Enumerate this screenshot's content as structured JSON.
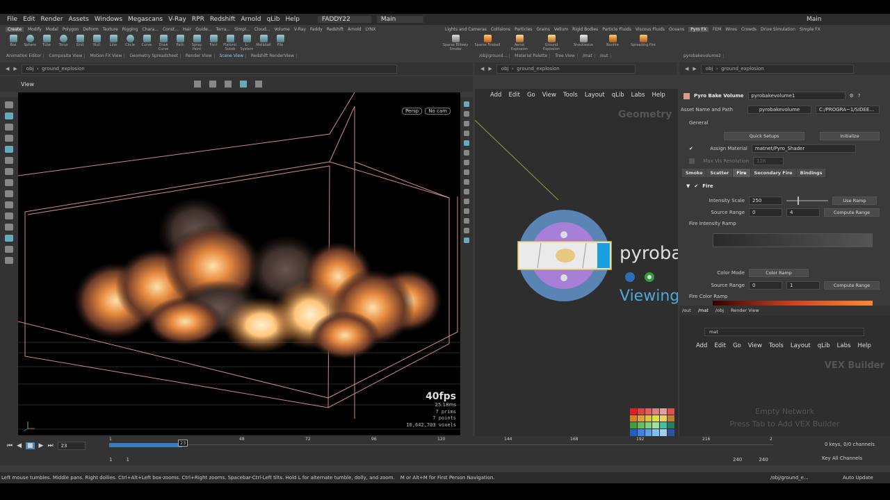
{
  "menu": [
    "File",
    "Edit",
    "Render",
    "Assets",
    "Windows",
    "Megascans",
    "V-Ray",
    "RPR",
    "Redshift",
    "Arnold",
    "qLib",
    "Help"
  ],
  "workspace": {
    "user": "FADDY22",
    "desktop": "Main",
    "right": "Main"
  },
  "shelf_tabs_left": [
    "Create",
    "Modify",
    "Model",
    "Polygon",
    "Deform",
    "Texture",
    "Rigging",
    "Chara...",
    "Const...",
    "Hair",
    "Guide...",
    "Terra...",
    "Simpl...",
    "Cloud...",
    "Volume",
    "V-Ray",
    "Faddy",
    "Redshift",
    "Arnold",
    "LYNX"
  ],
  "shelf_tabs_right": [
    "Lights and Cameras",
    "Collisions",
    "Particles",
    "Grains",
    "Vellum",
    "Rigid Bodies",
    "Particle Fluids",
    "Viscous Fluids",
    "Oceans",
    "Pyro FX",
    "FEM",
    "Wires",
    "Crowds",
    "Drive Simulation",
    "Simple FX"
  ],
  "tools_left": [
    "Box",
    "Sphere",
    "Tube",
    "Torus",
    "Grid",
    "Null",
    "Line",
    "Circle",
    "Curve",
    "Draw Curve",
    "Path",
    "Spray Paint",
    "Font",
    "Platonic Solids",
    "L-System",
    "Metaball",
    "File"
  ],
  "tools_right": [
    "Sparse Billowy Smoke",
    "Sparse Fireball",
    "Aerial Explosion",
    "Ground Explosion",
    "Shockwave",
    "Bonfire",
    "Spreading Fire"
  ],
  "pane_tabs_left": [
    "Animation Editor",
    "Composite View",
    "Motion FX View",
    "Geometry Spreadsheet",
    "Render View",
    "Scene View",
    "Redshift RenderView"
  ],
  "pane_tabs_mid": [
    "/obj/ground...",
    "Material Palette",
    "Tree View",
    "/mat",
    "/out"
  ],
  "pane_tabs_right": [
    "pyrobakevolume2"
  ],
  "path": {
    "root": "obj",
    "node": "ground_explosion"
  },
  "viewport": {
    "label": "View",
    "persp": "Persp",
    "cam": "No cam",
    "fps": "40fps",
    "ms": "25.18ms",
    "prims": "7  prims",
    "points": "7 points",
    "voxels": "10,642,703 voxels"
  },
  "network": {
    "menu": [
      "Add",
      "Edit",
      "Go",
      "View",
      "Tools",
      "Layout",
      "qLib",
      "Labs",
      "Help"
    ],
    "context": "Geometry",
    "node_name": "pyroba",
    "node_status": "Viewing"
  },
  "params": {
    "type": "Pyro Bake Volume",
    "name": "pyrobakevolume1",
    "asset_label": "Asset Name and Path",
    "asset": "pyrobakevolume",
    "asset_path": "C:/PROGRA~1/SIDEE...",
    "general": "General",
    "quick": "Quick Setups",
    "init": "Initialize",
    "assign_label": "Assign Material",
    "assign": "matnet/Pyro_Shader",
    "max_res_label": "Max Vis Resolution",
    "max_res": "128",
    "tabs": [
      "Smoke",
      "Scatter",
      "Fire",
      "Secondary Fire",
      "Bindings"
    ],
    "fire": "Fire",
    "intensity_label": "Intensity Scale",
    "intensity": "250",
    "use_ramp": "Use Ramp",
    "source_label": "Source Range",
    "src0": "0",
    "src1": "4",
    "compute": "Compute Range",
    "ramp_label": "Fire Intensity Ramp",
    "color_mode_label": "Color Mode",
    "color_mode": "Color Ramp",
    "source2_label": "Source Range",
    "src2_0": "0",
    "src2_1": "1",
    "compute2": "Compute Range",
    "color_ramp_label": "Fire Color Ramp"
  },
  "vex": {
    "tabs": [
      "/out",
      "/mat",
      "/obj",
      "Render View"
    ],
    "path": "mat",
    "menu": [
      "Add",
      "Edit",
      "Go",
      "View",
      "Tools",
      "Layout",
      "qLib",
      "Labs",
      "Help"
    ],
    "title": "VEX Builder",
    "empty1": "Empty Network",
    "empty2": "Press Tab to Add VEX Builder"
  },
  "timeline": {
    "frame": "23",
    "ticks": [
      "1",
      "48",
      "72",
      "96",
      "120",
      "144",
      "168",
      "192",
      "216",
      "2"
    ],
    "start": "1",
    "start2": "1",
    "end": "240",
    "end2": "240",
    "keys": "0 keys, 0/0 channels",
    "allch": "Key All Channels",
    "progress": 0.11
  },
  "status": {
    "hint": "Left mouse tumbles. Middle pans. Right dollies. Ctrl+Alt+Left box-zooms. Ctrl+Right zooms. Spacebar-Ctrl-Left tilts. Hold L for alternate tumble, dolly, and zoom.",
    "hint2": "M or Alt+M for First Person Navigation.",
    "path": "/obj/ground_e...",
    "update": "Auto Update"
  }
}
